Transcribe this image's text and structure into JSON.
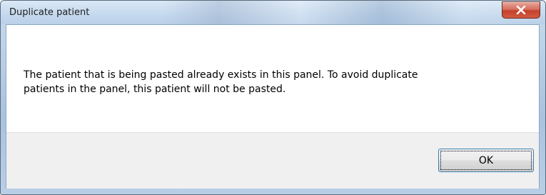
{
  "window": {
    "title": "Duplicate patient"
  },
  "dialog": {
    "message_line1": "The patient that is being pasted already exists in this panel.  To avoid duplicate",
    "message_line2": "patients in the panel, this patient will not be pasted."
  },
  "buttons": {
    "ok_label": "OK"
  },
  "icons": {
    "close": "close-icon"
  },
  "colors": {
    "titlebar": "#c8dbef",
    "close_button": "#c4412d",
    "dialog_body": "#ffffff",
    "button_area": "#f0f0f0",
    "focus_border": "#3c7fb1"
  }
}
